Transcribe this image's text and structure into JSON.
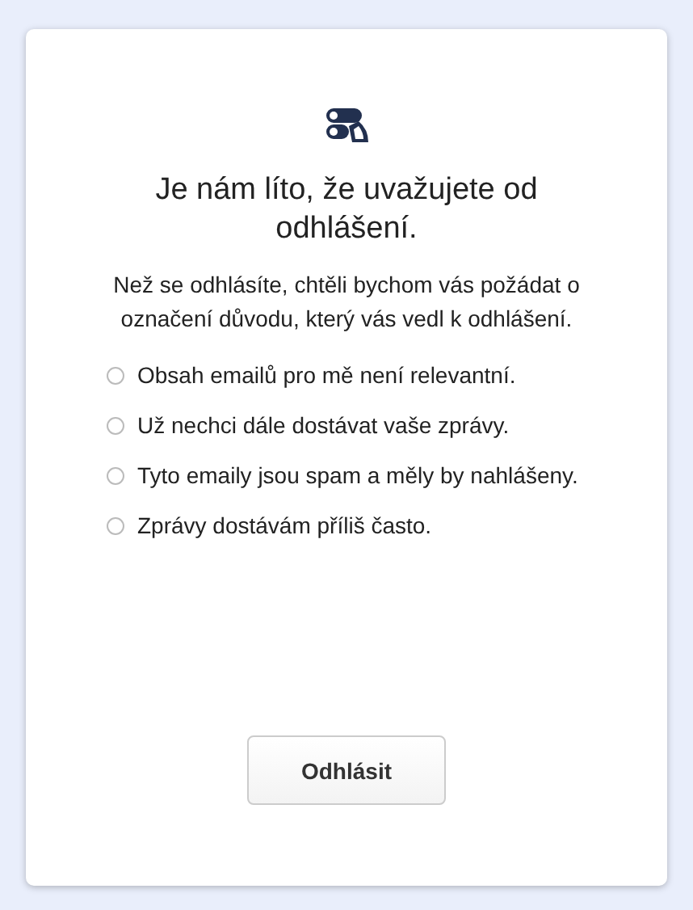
{
  "title": "Je nám líto, že uvažujete od odhlášení.",
  "description": "Než se odhlásíte, chtěli bychom vás požádat o označení důvodu, který vás vedl k odhlášení.",
  "options": [
    {
      "label": "Obsah emailů pro mě není relevantní.",
      "selected": false
    },
    {
      "label": "Už nechci dále dostávat vaše zprávy.",
      "selected": false
    },
    {
      "label": "Tyto emaily jsou spam a měly by nahlášeny.",
      "selected": false
    },
    {
      "label": "Zprávy dostávám příliš často.",
      "selected": false
    }
  ],
  "button": "Odhlásit"
}
